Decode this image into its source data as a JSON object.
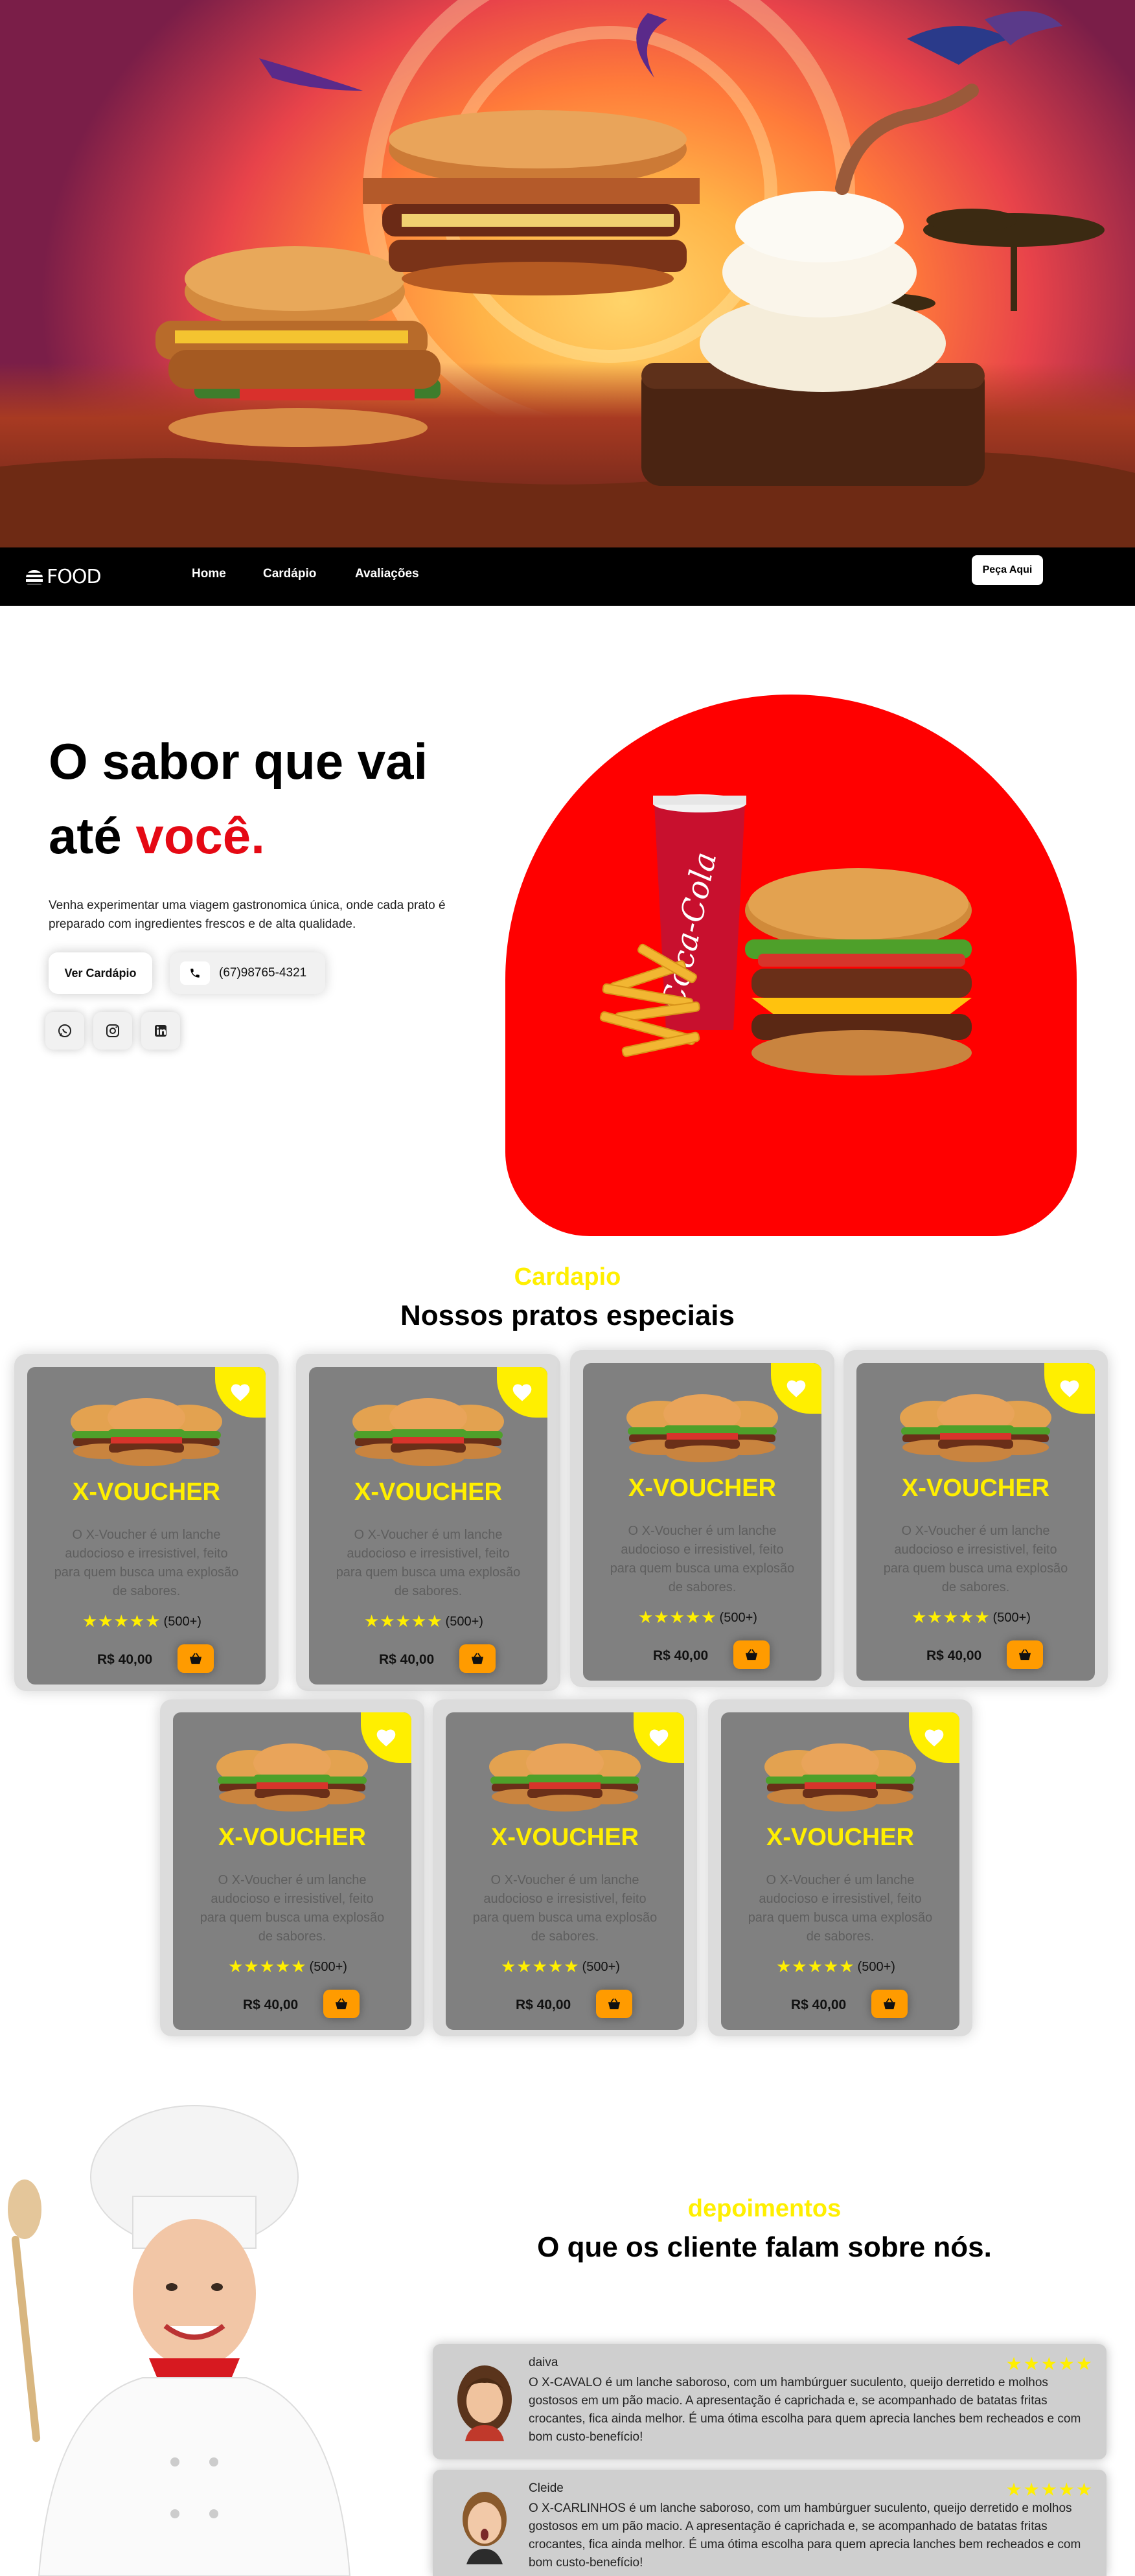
{
  "nav": {
    "logo": "FOOD",
    "links": [
      "Home",
      "Cardápio",
      "Avaliações"
    ],
    "order_button": "Peça Aqui"
  },
  "hero_intro": {
    "title_line1": "O sabor que vai",
    "title_line2_prefix": "até",
    "title_line2_accent": "você.",
    "description": "Venha experimentar uma viagem gastronomica única, onde cada prato é preparado com ingredientes frescos e de alta qualidade.",
    "menu_button": "Ver Cardápio",
    "phone": "(67)98765-4321",
    "social_icons": [
      "whatsapp-icon",
      "instagram-icon",
      "linkedin-icon"
    ]
  },
  "brand": {
    "can_text": "Coca-Cola"
  },
  "colors": {
    "accent_yellow": "#ffef00",
    "accent_red": "#ff0000",
    "cart_orange": "#ff9b00",
    "card_gray": "#808080"
  },
  "menu": {
    "eyebrow": "Cardapio",
    "title": "Nossos pratos especiais",
    "items": [
      {
        "name": "X-VOUCHER",
        "description": "O X-Voucher é um lanche audocioso e irresistivel, feito para quem busca uma explosão de sabores.",
        "stars": "★★★★★",
        "reviews": "(500+)",
        "price": "R$ 40,00"
      },
      {
        "name": "X-VOUCHER",
        "description": "O X-Voucher é um lanche audocioso e irresistivel, feito para quem busca uma explosão de sabores.",
        "stars": "★★★★★",
        "reviews": "(500+)",
        "price": "R$ 40,00"
      },
      {
        "name": "X-VOUCHER",
        "description": "O X-Voucher é um lanche audocioso e irresistivel, feito para quem busca uma explosão de sabores.",
        "stars": "★★★★★",
        "reviews": "(500+)",
        "price": "R$ 40,00"
      },
      {
        "name": "X-VOUCHER",
        "description": "O X-Voucher é um lanche audocioso e irresistivel, feito para quem busca uma explosão de sabores.",
        "stars": "★★★★★",
        "reviews": "(500+)",
        "price": "R$ 40,00"
      },
      {
        "name": "X-VOUCHER",
        "description": "O X-Voucher é um lanche audocioso e irresistivel, feito para quem busca uma explosão de sabores.",
        "stars": "★★★★★",
        "reviews": "(500+)",
        "price": "R$ 40,00"
      },
      {
        "name": "X-VOUCHER",
        "description": "O X-Voucher é um lanche audocioso e irresistivel, feito para quem busca uma explosão de sabores.",
        "stars": "★★★★★",
        "reviews": "(500+)",
        "price": "R$ 40,00"
      },
      {
        "name": "X-VOUCHER",
        "description": "O X-Voucher é um lanche audocioso e irresistivel, feito para quem busca uma explosão de sabores.",
        "stars": "★★★★★",
        "reviews": "(500+)",
        "price": "R$ 40,00"
      }
    ]
  },
  "testimonials": {
    "eyebrow": "depoimentos",
    "title": "O que os cliente falam sobre nós.",
    "items": [
      {
        "name": "daiva",
        "stars": "★★★★★",
        "text": "O X-CAVALO é um lanche saboroso, com um hambúrguer suculento, queijo derretido e molhos gostosos em um pão macio. A apresentação é caprichada e, se acompanhado de batatas fritas crocantes, fica ainda melhor. É uma ótima escolha para quem aprecia lanches bem recheados e com bom custo-benefício!"
      },
      {
        "name": "Cleide",
        "stars": "★★★★★",
        "text": "O X-CARLINHOS é um lanche saboroso, com um hambúrguer suculento, queijo derretido e molhos gostosos em um pão macio. A apresentação é caprichada e, se acompanhado de batatas fritas crocantes, fica ainda melhor. É uma ótima escolha para quem aprecia lanches bem recheados e com bom custo-benefício!"
      }
    ]
  }
}
